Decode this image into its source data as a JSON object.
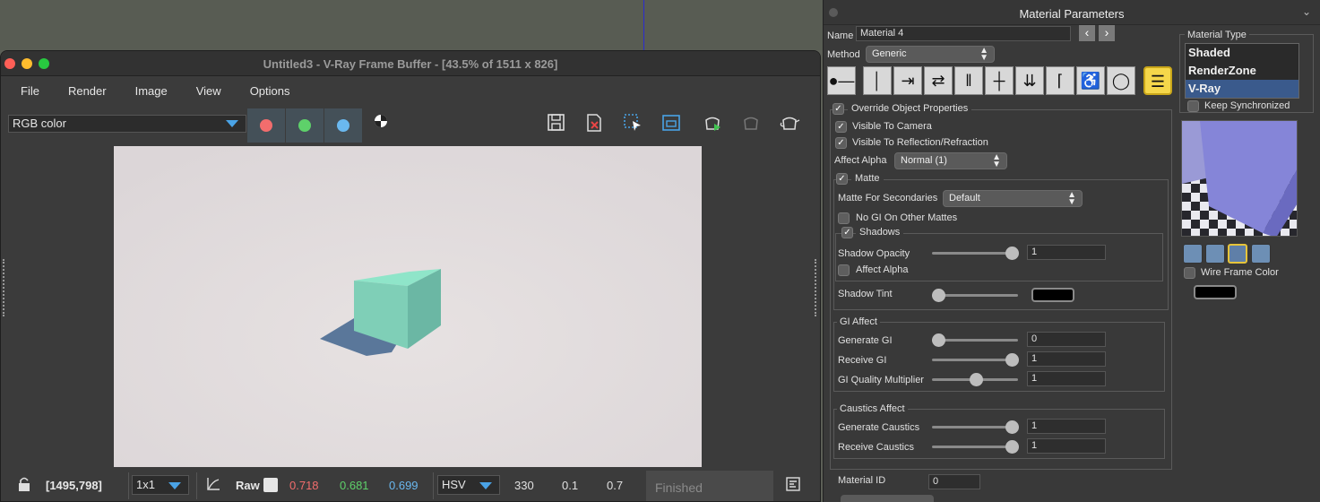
{
  "vfb": {
    "title": "Untitled3 - V-Ray Frame Buffer - [43.5% of 1511 x 826]",
    "menu": [
      "File",
      "Render",
      "Image",
      "View",
      "Options"
    ],
    "channel": "RGB color",
    "status": {
      "coords": "[1495,798]",
      "zoom": "1x1",
      "raw_label": "Raw",
      "r": "0.718",
      "g": "0.681",
      "b": "0.699",
      "color_mode": "HSV",
      "h": "330",
      "s": "0.1",
      "v": "0.7",
      "progress": "Finished"
    },
    "colors": {
      "red": "#f26d6d",
      "green": "#5ed16a",
      "blue": "#6ab8ef",
      "accent": "#4aa3e6"
    }
  },
  "mp": {
    "title": "Material Parameters",
    "name_label": "Name",
    "name_value": "Material 4",
    "method_label": "Method",
    "method_value": "Generic",
    "override": "Override Object Properties",
    "visible_camera": "Visible To Camera",
    "visible_reflection": "Visible To Reflection/Refraction",
    "affect_alpha_label": "Affect Alpha",
    "affect_alpha_value": "Normal (1)",
    "matte": "Matte",
    "matte_secondaries_label": "Matte For Secondaries",
    "matte_secondaries_value": "Default",
    "no_gi": "No GI On Other Mattes",
    "shadows": "Shadows",
    "shadow_opacity_label": "Shadow Opacity",
    "shadow_opacity_value": "1",
    "shadow_affect_alpha": "Affect Alpha",
    "shadow_tint_label": "Shadow Tint",
    "gi_affect": "GI Affect",
    "generate_gi_label": "Generate GI",
    "generate_gi_value": "0",
    "receive_gi_label": "Receive GI",
    "receive_gi_value": "1",
    "gi_quality_label": "GI Quality Multiplier",
    "gi_quality_value": "1",
    "caustics_affect": "Caustics Affect",
    "generate_caustics_label": "Generate Caustics",
    "generate_caustics_value": "1",
    "receive_caustics_label": "Receive Caustics",
    "receive_caustics_value": "1",
    "material_id_label": "Material ID",
    "material_id_value": "0",
    "material_type_label": "Material Type",
    "material_types": [
      "Shaded",
      "RenderZone",
      "V-Ray"
    ],
    "keep_sync": "Keep Synchronized",
    "wire_frame_color": "Wire Frame Color"
  }
}
